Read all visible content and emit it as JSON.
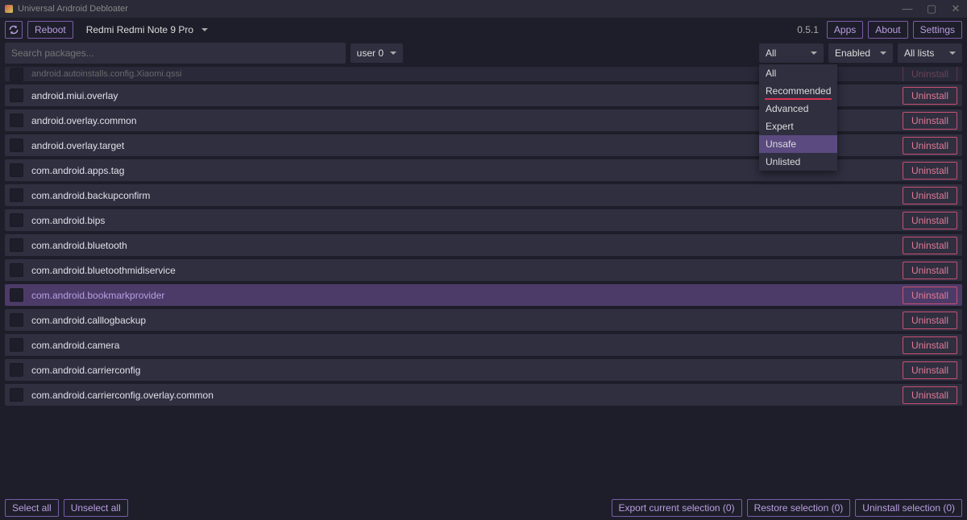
{
  "titlebar": {
    "title": "Universal Android Debloater",
    "minimize": "—",
    "maximize": "▢",
    "close": "✕"
  },
  "toolbar": {
    "reboot_label": "Reboot",
    "device": "Redmi Redmi Note 9 Pro",
    "version": "0.5.1",
    "apps_label": "Apps",
    "about_label": "About",
    "settings_label": "Settings"
  },
  "filter_bar": {
    "search_placeholder": "Search packages...",
    "user": "user 0",
    "filter1": {
      "value": "All",
      "options": [
        "All",
        "Recommended",
        "Advanced",
        "Expert",
        "Unsafe",
        "Unlisted"
      ],
      "highlight": "Unsafe"
    },
    "filter2": "Enabled",
    "filter3": "All lists"
  },
  "packages": [
    {
      "name": "android.autoinstalls.config.Xiaomi.qssi",
      "clipped": true
    },
    {
      "name": "android.miui.overlay"
    },
    {
      "name": "android.overlay.common"
    },
    {
      "name": "android.overlay.target"
    },
    {
      "name": "com.android.apps.tag"
    },
    {
      "name": "com.android.backupconfirm"
    },
    {
      "name": "com.android.bips"
    },
    {
      "name": "com.android.bluetooth"
    },
    {
      "name": "com.android.bluetoothmidiservice"
    },
    {
      "name": "com.android.bookmarkprovider",
      "selected": true
    },
    {
      "name": "com.android.calllogbackup"
    },
    {
      "name": "com.android.camera"
    },
    {
      "name": "com.android.carrierconfig"
    },
    {
      "name": "com.android.carrierconfig.overlay.common"
    }
  ],
  "uninstall_label": "Uninstall",
  "bottom_bar": {
    "select_all": "Select all",
    "unselect_all": "Unselect all",
    "export": "Export current selection (0)",
    "restore": "Restore selection (0)",
    "uninstall_sel": "Uninstall selection (0)"
  }
}
